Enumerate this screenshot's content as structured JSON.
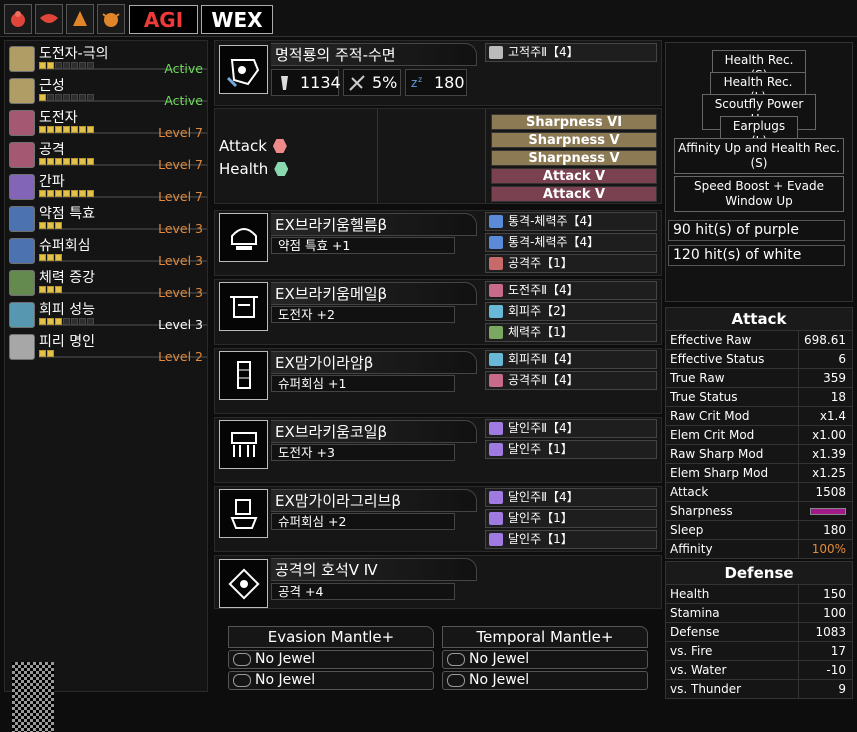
{
  "topbar": {
    "icons": [
      "monster-icon-1",
      "monster-icon-2",
      "monster-icon-3",
      "monster-icon-4"
    ],
    "agi": "AGI",
    "wex": "WEX"
  },
  "skills": [
    {
      "name": "도전자-극의",
      "level_text": "Active",
      "filled": 2,
      "total": 7,
      "color": "#6ddc5a",
      "icon_color": "#d8c07a"
    },
    {
      "name": "근성",
      "level_text": "Active",
      "filled": 1,
      "total": 7,
      "color": "#6ddc5a",
      "icon_color": "#d8c07a"
    },
    {
      "name": "도전자",
      "level_text": "Level 7",
      "filled": 7,
      "total": 7,
      "color": "#e08a3c",
      "icon_color": "#c86a8a"
    },
    {
      "name": "공격",
      "level_text": "Level 7",
      "filled": 7,
      "total": 7,
      "color": "#e08a3c",
      "icon_color": "#c86a8a"
    },
    {
      "name": "간파",
      "level_text": "Level 7",
      "filled": 7,
      "total": 7,
      "color": "#e08a3c",
      "icon_color": "#9f7ae0"
    },
    {
      "name": "약점 특효",
      "level_text": "Level 3",
      "filled": 3,
      "total": 3,
      "color": "#e08a3c",
      "icon_color": "#5a8ad8"
    },
    {
      "name": "슈퍼회심",
      "level_text": "Level 3",
      "filled": 3,
      "total": 3,
      "color": "#e08a3c",
      "icon_color": "#5a8ad8"
    },
    {
      "name": "체력 증강",
      "level_text": "Level 3",
      "filled": 3,
      "total": 3,
      "color": "#e08a3c",
      "icon_color": "#7aa860"
    },
    {
      "name": "회피 성능",
      "level_text": "Level 3",
      "filled": 3,
      "total": 7,
      "color": "#ffffff",
      "icon_color": "#6ab8d8"
    },
    {
      "name": "피리 명인",
      "level_text": "Level 2",
      "filled": 2,
      "total": 2,
      "color": "#e08a3c",
      "icon_color": "#cccccc"
    }
  ],
  "weapon": {
    "name": "명적룡의 주적-수면",
    "attack": "1134",
    "affinity": "5%",
    "sleep": "180",
    "slot": "고적주Ⅱ【4】",
    "songs": [
      {
        "label": "Attack",
        "color": "#f08a8a"
      },
      {
        "label": "Health",
        "color": "#8ad8b0"
      }
    ],
    "sharpness": [
      {
        "label": "Sharpness VI",
        "bg": "#8c7a55"
      },
      {
        "label": "Sharpness V",
        "bg": "#8c7a55"
      },
      {
        "label": "Sharpness V",
        "bg": "#8c7a55"
      },
      {
        "label": "Attack V",
        "bg": "#7a4250"
      },
      {
        "label": "Attack V",
        "bg": "#7a4250"
      }
    ]
  },
  "armor": [
    {
      "name": "EX브라키움헬름β",
      "skill": "약점 특효 +1",
      "slots": [
        {
          "label": "통격-체력주【4】",
          "color": "#5a8ad8"
        },
        {
          "label": "통격-체력주【4】",
          "color": "#5a8ad8"
        },
        {
          "label": "공격주【1】",
          "color": "#c86a6a"
        }
      ]
    },
    {
      "name": "EX브라키움메일β",
      "skill": "도전자 +2",
      "slots": [
        {
          "label": "도전주Ⅱ【4】",
          "color": "#c86a8a"
        },
        {
          "label": "회피주【2】",
          "color": "#6ab8d8"
        },
        {
          "label": "체력주【1】",
          "color": "#7aa860"
        }
      ]
    },
    {
      "name": "EX맘가이라암β",
      "skill": "슈퍼회심 +1",
      "slots": [
        {
          "label": "회피주Ⅱ【4】",
          "color": "#6ab8d8"
        },
        {
          "label": "공격주Ⅱ【4】",
          "color": "#c86a8a"
        }
      ]
    },
    {
      "name": "EX브라키움코일β",
      "skill": "도전자 +3",
      "slots": [
        {
          "label": "달인주Ⅱ【4】",
          "color": "#9f7ae0"
        },
        {
          "label": "달인주【1】",
          "color": "#9f7ae0"
        }
      ]
    },
    {
      "name": "EX맘가이라그리브β",
      "skill": "슈퍼회심 +2",
      "slots": [
        {
          "label": "달인주Ⅱ【4】",
          "color": "#9f7ae0"
        },
        {
          "label": "달인주【1】",
          "color": "#9f7ae0"
        },
        {
          "label": "달인주【1】",
          "color": "#9f7ae0"
        }
      ]
    }
  ],
  "charm": {
    "name": "공격의 호석Ⅴ Ⅳ",
    "skill": "공격 +4"
  },
  "mantles": [
    {
      "name": "Evasion Mantle+",
      "jewels": [
        "No Jewel",
        "No Jewel"
      ]
    },
    {
      "name": "Temporal Mantle+",
      "jewels": [
        "No Jewel",
        "No Jewel"
      ]
    }
  ],
  "song_effects": [
    "Health Rec. (S)",
    "Health Rec. (L)",
    "Scoutfly Power Up",
    "Earplugs (L)",
    "Affinity Up and Health Rec. (S)",
    "Speed Boost + Evade Window Up"
  ],
  "hits": [
    "90 hit(s) of purple",
    "120 hit(s) of white"
  ],
  "attack_table": {
    "title": "Attack",
    "rows": [
      {
        "k": "Effective Raw",
        "v": "698.61"
      },
      {
        "k": "Effective Status",
        "v": "6"
      },
      {
        "k": "True Raw",
        "v": "359"
      },
      {
        "k": "True Status",
        "v": "18"
      },
      {
        "k": "Raw Crit Mod",
        "v": "x1.4"
      },
      {
        "k": "Elem Crit Mod",
        "v": "x1.00"
      },
      {
        "k": "Raw Sharp Mod",
        "v": "x1.39"
      },
      {
        "k": "Elem Sharp Mod",
        "v": "x1.25"
      },
      {
        "k": "Attack",
        "v": "1508"
      },
      {
        "k": "Sharpness",
        "v": ""
      },
      {
        "k": "Sleep",
        "v": "180"
      },
      {
        "k": "Affinity",
        "v": "100%"
      }
    ]
  },
  "defense_table": {
    "title": "Defense",
    "rows": [
      {
        "k": "Health",
        "v": "150"
      },
      {
        "k": "Stamina",
        "v": "100"
      },
      {
        "k": "Defense",
        "v": "1083"
      },
      {
        "k": "vs. Fire",
        "v": "17"
      },
      {
        "k": "vs. Water",
        "v": "-10"
      },
      {
        "k": "vs. Thunder",
        "v": "9"
      }
    ]
  },
  "colors": {
    "affinity": "#e08a3c",
    "sharpness_bar": "#a01a8a"
  }
}
